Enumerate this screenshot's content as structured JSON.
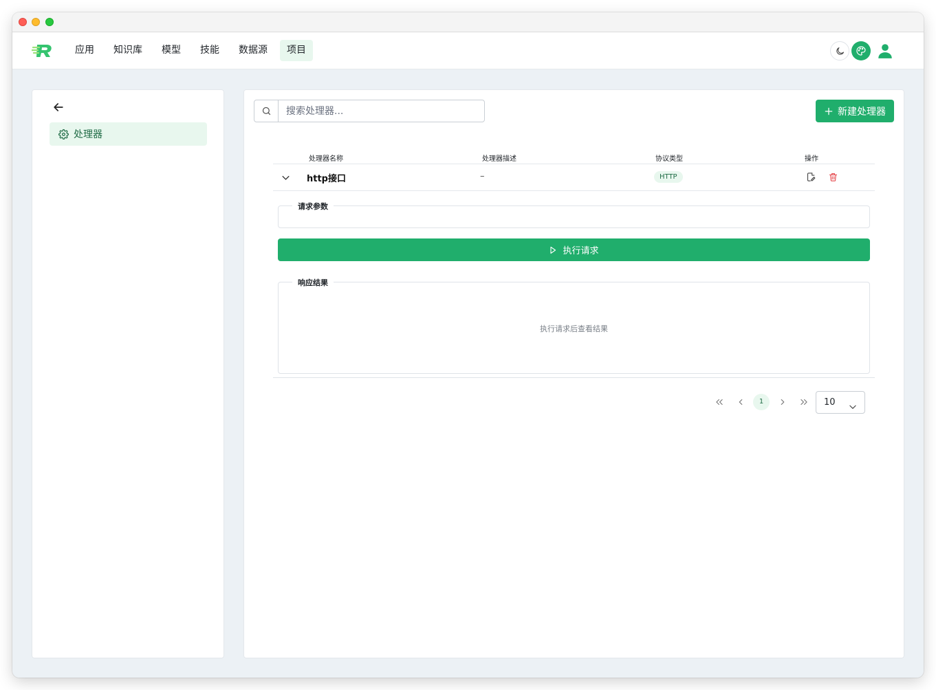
{
  "nav": {
    "items": [
      {
        "label": "应用"
      },
      {
        "label": "知识库"
      },
      {
        "label": "模型"
      },
      {
        "label": "技能"
      },
      {
        "label": "数据源"
      },
      {
        "label": "项目",
        "active": true
      }
    ],
    "icons": {
      "theme": "moon-icon",
      "palette": "palette-icon",
      "user": "user-icon"
    }
  },
  "sidebar": {
    "back_icon": "arrow-left-icon",
    "items": [
      {
        "label": "处理器",
        "icon": "gear-icon",
        "active": true
      }
    ]
  },
  "main": {
    "search": {
      "placeholder": "搜索处理器..."
    },
    "new_button_label": "新建处理器",
    "table": {
      "headers": [
        "处理器名称",
        "处理器描述",
        "协议类型",
        "操作"
      ],
      "rows": [
        {
          "name": "http接口",
          "description": "–",
          "protocol": "HTTP"
        }
      ]
    },
    "expanded": {
      "request_params_label": "请求参数",
      "execute_button_label": "执行请求",
      "response_label": "响应结果",
      "response_empty": "执行请求后查看结果"
    },
    "pagination": {
      "current_page": "1",
      "page_size": "10"
    }
  },
  "colors": {
    "accent": "#20ae6c",
    "accent_light": "#e8f7ee",
    "danger": "#e5484d",
    "bg": "#ecf1f5"
  }
}
